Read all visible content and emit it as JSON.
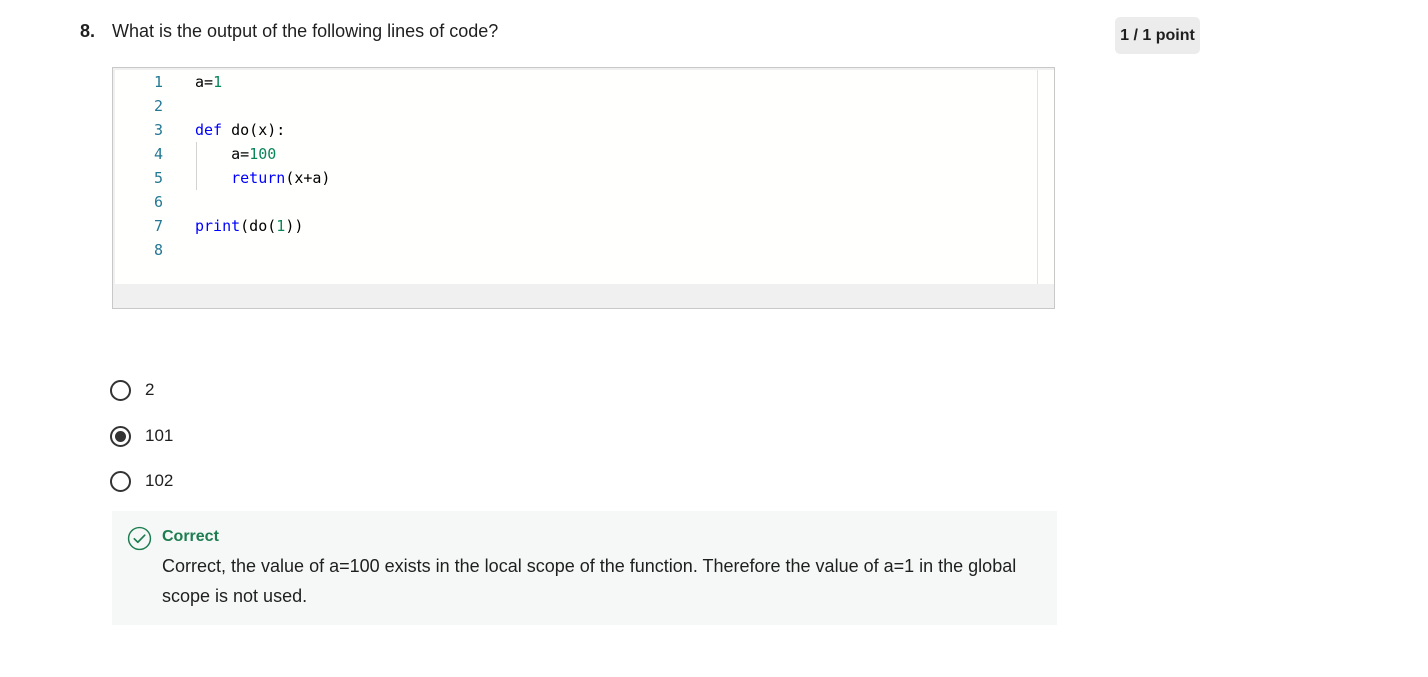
{
  "question": {
    "number": "8.",
    "text": "What is the output of the following lines of code?",
    "points": "1 / 1 point"
  },
  "code": {
    "line_numbers": [
      "1",
      "2",
      "3",
      "4",
      "5",
      "6",
      "7",
      "8"
    ],
    "lines": [
      "a=1",
      "",
      "def do(x):",
      "    a=100",
      "    return(x+a)",
      "",
      "print(do(1))",
      ""
    ]
  },
  "options": [
    {
      "label": "2",
      "selected": false
    },
    {
      "label": "101",
      "selected": true
    },
    {
      "label": "102",
      "selected": false
    }
  ],
  "feedback": {
    "status": "Correct",
    "message": "Correct, the value of a=100 exists in the local scope of the function. Therefore the value of a=1 in the global scope is not used.",
    "icon": "check-circle-icon",
    "status_color": "#1d7c50"
  },
  "colors": {
    "keyword": "#0000ff",
    "number": "#098658",
    "line_number": "#237893"
  }
}
